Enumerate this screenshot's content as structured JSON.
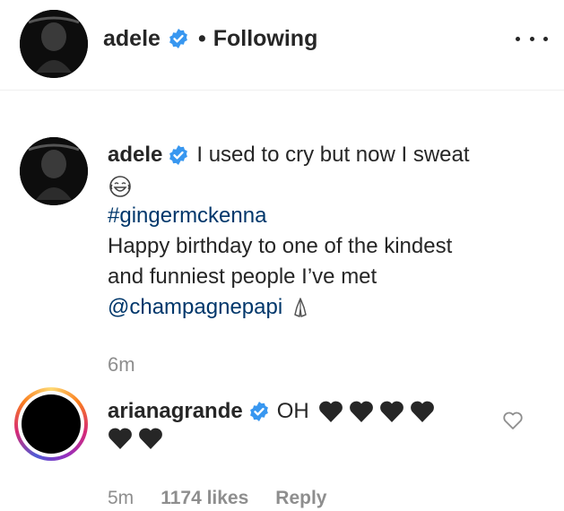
{
  "header": {
    "username": "adele",
    "separator": "•",
    "follow_status": "Following",
    "more_icon": "more-horizontal-icon"
  },
  "caption": {
    "username": "adele",
    "text_line1": "I used to cry but now I sweat",
    "emoji_1": "laughing-crying-emoji",
    "hashtag": "#gingermckenna",
    "text_line2": "Happy birthday to one of the kindest",
    "text_line3": "and funniest people I’ve met",
    "mention": "@champagnepapi",
    "emoji_2": "praying-hands-emoji",
    "time": "6m"
  },
  "comment": {
    "username": "arianagrande",
    "text": "OH",
    "hearts_line1": 4,
    "hearts_line2": 2,
    "heart_color": "#262626",
    "time": "5m",
    "likes": "1174 likes",
    "reply_label": "Reply"
  },
  "colors": {
    "verified": "#3897f0",
    "link": "#00376b",
    "muted": "#8e8e8e",
    "text": "#262626"
  }
}
